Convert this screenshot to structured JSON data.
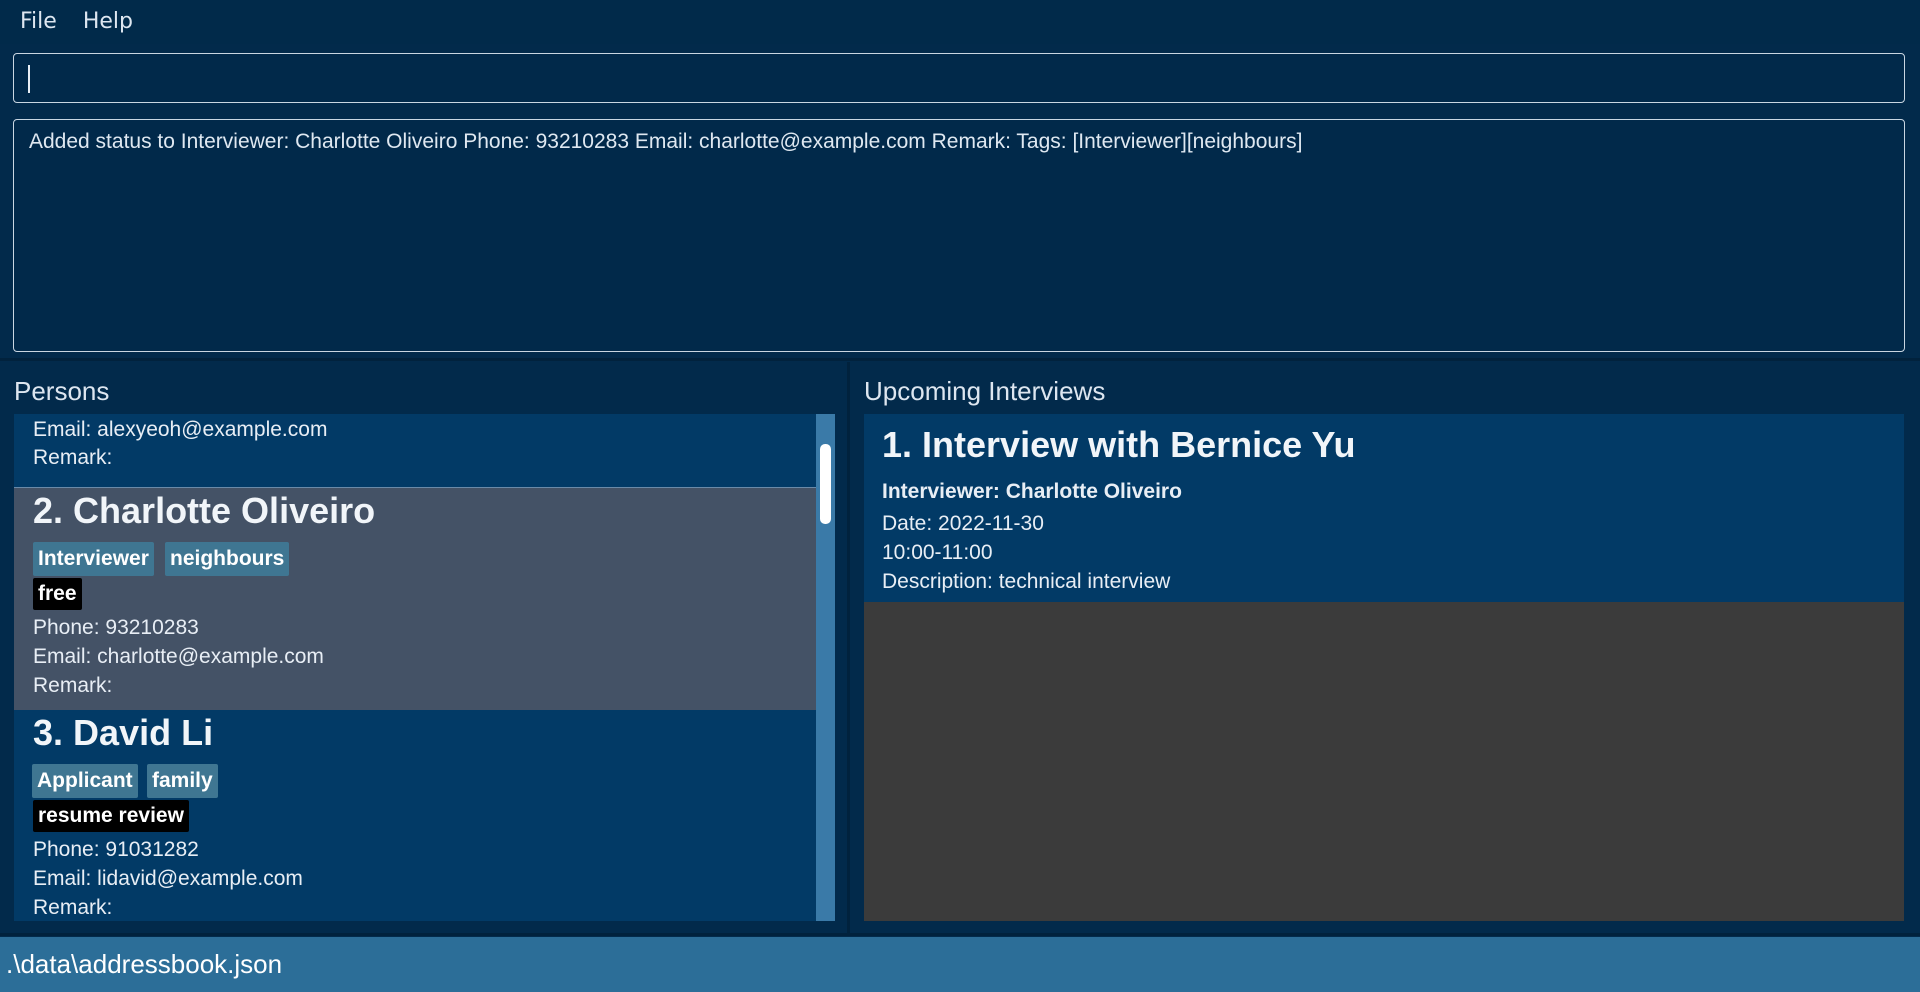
{
  "menu": {
    "file": "File",
    "help": "Help"
  },
  "command": {
    "value": ""
  },
  "result": {
    "text": "Added status to Interviewer: Charlotte Oliveiro Phone: 93210283 Email: charlotte@example.com Remark:  Tags: [Interviewer][neighbours]"
  },
  "persons": {
    "title": "Persons",
    "partial_card": {
      "email": "Email: alexyeoh@example.com",
      "remark": "Remark:"
    },
    "cards": [
      {
        "index": "2.",
        "name": "Charlotte Oliveiro",
        "tags": [
          "Interviewer",
          "neighbours"
        ],
        "status": "free",
        "phone": "Phone: 93210283",
        "email": "Email: charlotte@example.com",
        "remark": "Remark:"
      },
      {
        "index": "3.",
        "name": "David Li",
        "tags": [
          "Applicant",
          "family"
        ],
        "status": "resume review",
        "phone": "Phone: 91031282",
        "email": "Email: lidavid@example.com",
        "remark": "Remark:"
      }
    ]
  },
  "interviews": {
    "title": "Upcoming Interviews",
    "items": [
      {
        "index": "1.",
        "title": "Interview with Bernice Yu",
        "interviewer": "Interviewer: Charlotte Oliveiro",
        "date": "Date: 2022-11-30",
        "time": "10:00-11:00",
        "description": "Description: technical interview"
      }
    ]
  },
  "status_bar": {
    "path": ".\\data\\addressbook.json"
  },
  "colors": {
    "background": "#022a4b",
    "card": "#023a66",
    "selected_card": "#445266",
    "tag": "#3f7692",
    "status_tag": "#000000",
    "status_bar": "#2c6e98",
    "empty_list": "#3b3b3b"
  }
}
